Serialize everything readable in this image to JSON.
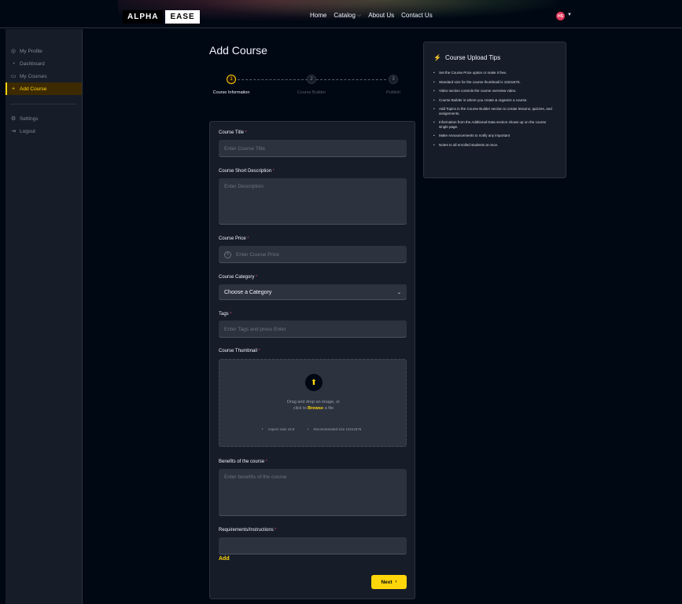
{
  "navbar": {
    "logo_part1": "ALPHA",
    "logo_part2": "EASE",
    "links": [
      "Home",
      "Catalog",
      "About Us",
      "Contact Us"
    ],
    "avatar_initials": "HS"
  },
  "sidebar": {
    "items": [
      {
        "label": "My Profile",
        "icon": "user-icon"
      },
      {
        "label": "Dashboard",
        "icon": "dashboard-icon"
      },
      {
        "label": "My Courses",
        "icon": "courses-icon"
      },
      {
        "label": "Add Course",
        "icon": "plus-icon"
      }
    ],
    "bottom_items": [
      {
        "label": "Settings",
        "icon": "gear-icon"
      },
      {
        "label": "Logout",
        "icon": "logout-icon"
      }
    ]
  },
  "page": {
    "title": "Add Course"
  },
  "stepper": {
    "steps": [
      {
        "number": "1",
        "label": "Course Information"
      },
      {
        "number": "2",
        "label": "Course Builder"
      },
      {
        "number": "3",
        "label": "Publish"
      }
    ]
  },
  "form": {
    "title_label": "Course Title",
    "title_placeholder": "Enter Course Title",
    "short_desc_label": "Course Short Description",
    "short_desc_placeholder": "Enter Description",
    "price_label": "Course Price",
    "price_placeholder": "Enter Course Price",
    "category_label": "Course Category",
    "category_selected": "Choose a Category",
    "tags_label": "Tags",
    "tags_placeholder": "Enter Tags and press Enter",
    "thumbnail_label": "Course Thumbnail",
    "thumbnail_text1": "Drag and drop an image, or",
    "thumbnail_text2_pre": "click to",
    "thumbnail_browse": "Browse",
    "thumbnail_text2_post": "a file",
    "thumbnail_hint1": "Aspect ratio 16:9",
    "thumbnail_hint2": "Recommended size 1024x576",
    "benefits_label": "Benefits of the course",
    "benefits_placeholder": "Enter benefits of the course",
    "requirements_label": "Requirements/Instructions",
    "add_label": "Add",
    "next_label": "Next"
  },
  "tips": {
    "title": "Course Upload Tips",
    "items": [
      "Set the Course Price option or make it free.",
      "Standard size for the course thumbnail is 1024x576.",
      "Video section controls the course overview video.",
      "Course Builder is where you create & organize a course.",
      "Add Topics in the Course Builder section to create lessons, quizzes, and assignments.",
      "Information from the Additional Data section shows up on the course single page.",
      "Make Announcements to notify any important",
      "Notes to all enrolled students at once."
    ]
  },
  "colors": {
    "accent": "#ffd60a",
    "background": "#000814",
    "panel": "#161d29",
    "input": "#2c333f",
    "required": "#ef476f"
  }
}
